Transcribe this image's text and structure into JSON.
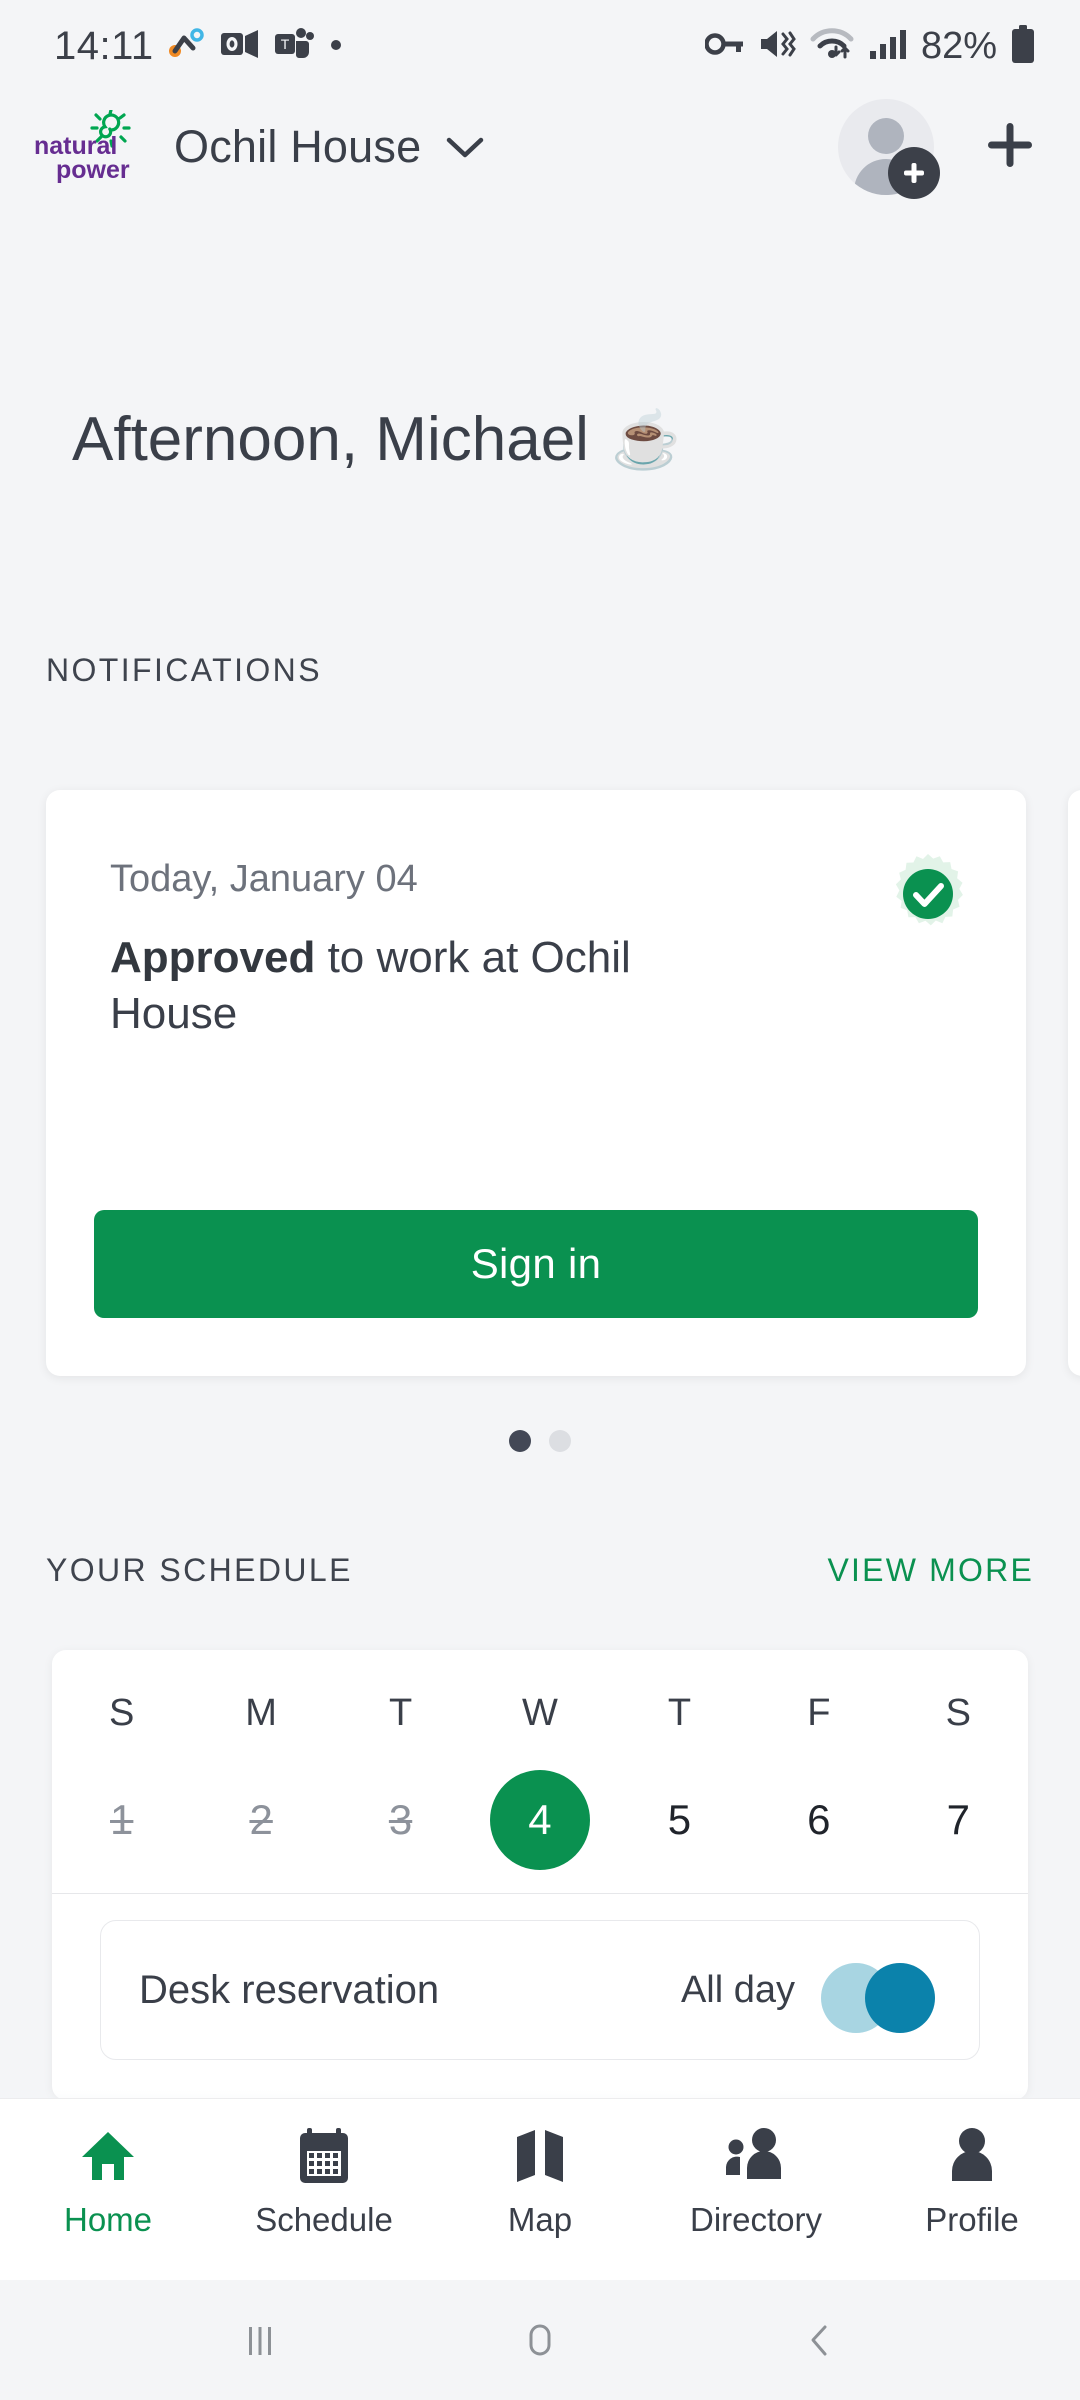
{
  "status_bar": {
    "time": "14:11",
    "left_icons": [
      "activity-graph-icon",
      "outlook-icon",
      "teams-icon",
      "dot-icon"
    ],
    "right_icons": [
      "vpn-key-icon",
      "mute-vibrate-icon",
      "wifi-icon",
      "signal-bars-icon"
    ],
    "battery_percent": "82%",
    "battery_icon": "battery-icon"
  },
  "app_bar": {
    "logo_line1": "natural",
    "logo_line2": "power",
    "logo_icon": "sun-spiral-icon",
    "site_title": "Ochil House",
    "site_chevron_icon": "chevron-down-icon",
    "avatar_icon": "avatar-add-person-icon",
    "add_icon": "plus-icon"
  },
  "greeting": {
    "text": "Afternoon, Michael",
    "emoji": "☕"
  },
  "notifications": {
    "section_label": "NOTIFICATIONS",
    "cards": [
      {
        "date": "Today, January 04",
        "message_bold": "Approved",
        "message_rest": " to work at Ochil House",
        "badge_icon": "verified-check-icon",
        "action_label": "Sign in"
      }
    ],
    "pager": {
      "total": 2,
      "active_index": 0
    }
  },
  "schedule": {
    "section_label": "YOUR SCHEDULE",
    "view_more_label": "VIEW MORE",
    "day_initials": [
      "S",
      "M",
      "T",
      "W",
      "T",
      "F",
      "S"
    ],
    "days": [
      {
        "number": "1",
        "state": "past"
      },
      {
        "number": "2",
        "state": "past"
      },
      {
        "number": "3",
        "state": "past"
      },
      {
        "number": "4",
        "state": "today"
      },
      {
        "number": "5",
        "state": "future"
      },
      {
        "number": "6",
        "state": "future"
      },
      {
        "number": "7",
        "state": "future"
      }
    ],
    "events": [
      {
        "title": "Desk reservation",
        "when": "All day",
        "attendee_colors": [
          "#a8d5e2",
          "#0b82ab"
        ]
      }
    ]
  },
  "bottom_nav": {
    "items": [
      {
        "label": "Home",
        "icon": "home-icon",
        "active": true
      },
      {
        "label": "Schedule",
        "icon": "calendar-icon",
        "active": false
      },
      {
        "label": "Map",
        "icon": "map-icon",
        "active": false
      },
      {
        "label": "Directory",
        "icon": "people-icon",
        "active": false
      },
      {
        "label": "Profile",
        "icon": "person-icon",
        "active": false
      }
    ]
  },
  "system_nav": {
    "recents_icon": "recents-icon",
    "home_icon": "home-square-icon",
    "back_icon": "back-chevron-icon"
  },
  "colors": {
    "accent_green": "#0a9150",
    "brand_purple": "#662d91",
    "brand_green": "#00a651",
    "text_dark": "#3a3f49",
    "background": "#f4f5f7"
  }
}
